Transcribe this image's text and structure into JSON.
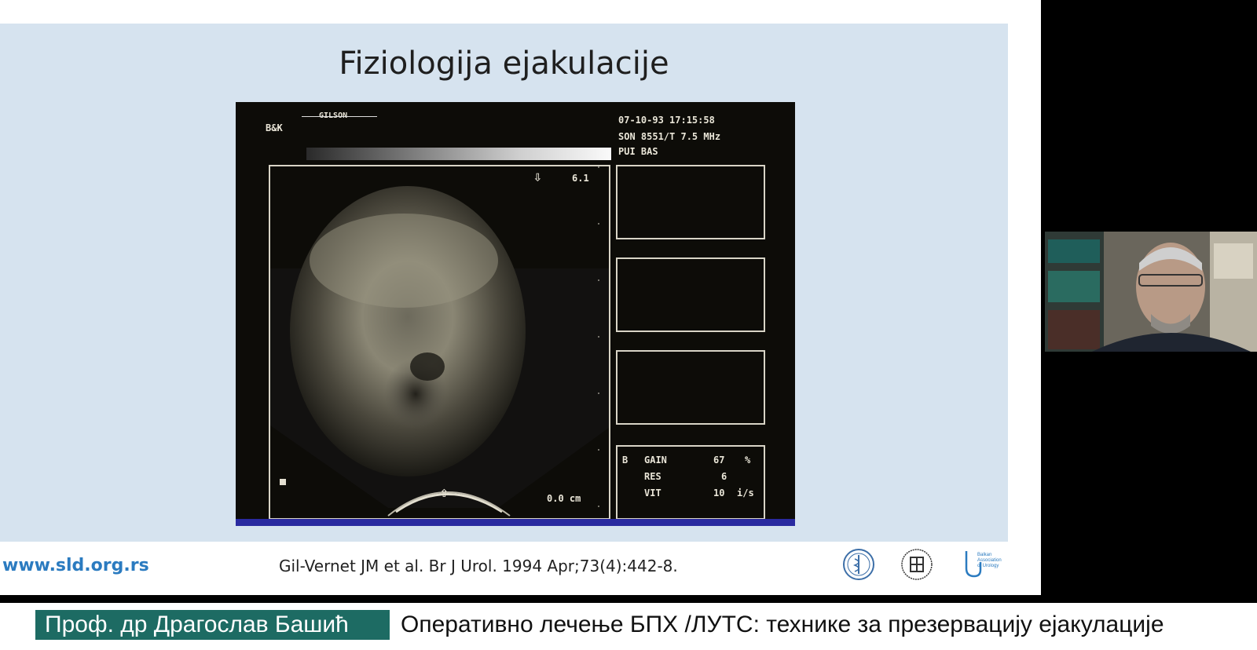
{
  "slide": {
    "title": "Fiziologija ejakulacije",
    "footer_url": "www.sld.org.rs",
    "citation": "Gil-Vernet JM et al. Br J Urol. 1994 Apr;73(4):442-8.",
    "ultrasound": {
      "brand": "B&K",
      "operator": "GILSON",
      "datetime": "07-10-93  17:15:58",
      "probe": "SON 8551/T  7.5 MHz",
      "mode": "PUI   BAS",
      "depth_top": "6.1",
      "depth_bottom": "0.0 cm",
      "params": [
        {
          "key": "B",
          "name": "GAIN",
          "value": "67",
          "unit": "%"
        },
        {
          "key": "",
          "name": "RES",
          "value": "6",
          "unit": ""
        },
        {
          "key": "",
          "name": "VIT",
          "value": "10",
          "unit": "i/s"
        }
      ]
    },
    "logos": [
      {
        "name": "serbian-medical-society-logo",
        "color": "#3d6fa8"
      },
      {
        "name": "association-crest-logo",
        "color": "#333333"
      },
      {
        "name": "balkan-association-of-urology-logo",
        "color": "#2b7bc0",
        "lettering": "Balkan Association of Urology"
      }
    ]
  },
  "banner": {
    "presenter": "Проф. др Драгослав Башић",
    "talk_title": "Оперативно лечење БПХ /ЛУТС: технике за презервацију ејакулације",
    "accent_color": "#1d6b63"
  }
}
